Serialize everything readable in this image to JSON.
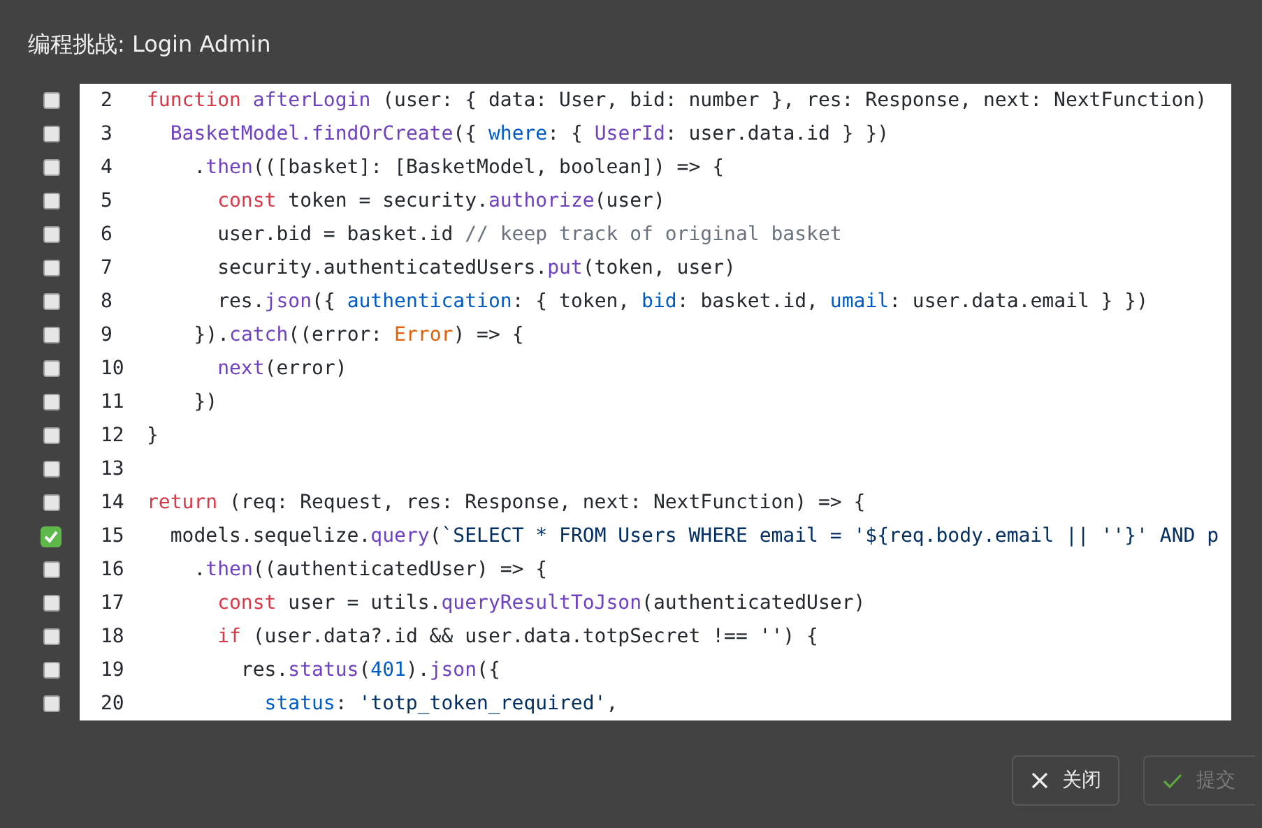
{
  "dialog": {
    "title": "编程挑战: Login Admin"
  },
  "code": {
    "lines": [
      {
        "number": "2",
        "checked": false,
        "tokens": [
          {
            "kind": "kw",
            "text": "function "
          },
          {
            "kind": "fn",
            "text": "afterLogin"
          },
          {
            "kind": "plain",
            "text": " (user: { data: User, bid: number }, res: Response, next: NextFunction)"
          }
        ]
      },
      {
        "number": "3",
        "checked": false,
        "tokens": [
          {
            "kind": "fn",
            "text": "  BasketModel."
          },
          {
            "kind": "fn",
            "text": "findOrCreate"
          },
          {
            "kind": "plain",
            "text": "({ "
          },
          {
            "kind": "prop",
            "text": "where"
          },
          {
            "kind": "plain",
            "text": ": { "
          },
          {
            "kind": "fn",
            "text": "UserId"
          },
          {
            "kind": "plain",
            "text": ": user.data.id } })"
          }
        ]
      },
      {
        "number": "4",
        "checked": false,
        "tokens": [
          {
            "kind": "plain",
            "text": "    ."
          },
          {
            "kind": "fn",
            "text": "then"
          },
          {
            "kind": "plain",
            "text": "(([basket]: [BasketModel, boolean]) => {"
          }
        ]
      },
      {
        "number": "5",
        "checked": false,
        "tokens": [
          {
            "kind": "kw",
            "text": "      const"
          },
          {
            "kind": "plain",
            "text": " token = security."
          },
          {
            "kind": "fn",
            "text": "authorize"
          },
          {
            "kind": "plain",
            "text": "(user)"
          }
        ]
      },
      {
        "number": "6",
        "checked": false,
        "tokens": [
          {
            "kind": "plain",
            "text": "      user.bid = basket.id "
          },
          {
            "kind": "comment",
            "text": "// keep track of original basket"
          }
        ]
      },
      {
        "number": "7",
        "checked": false,
        "tokens": [
          {
            "kind": "plain",
            "text": "      security.authenticatedUsers."
          },
          {
            "kind": "fn",
            "text": "put"
          },
          {
            "kind": "plain",
            "text": "(token, user)"
          }
        ]
      },
      {
        "number": "8",
        "checked": false,
        "tokens": [
          {
            "kind": "plain",
            "text": "      res."
          },
          {
            "kind": "fn",
            "text": "json"
          },
          {
            "kind": "plain",
            "text": "({ "
          },
          {
            "kind": "prop",
            "text": "authentication"
          },
          {
            "kind": "plain",
            "text": ": { token, "
          },
          {
            "kind": "prop",
            "text": "bid"
          },
          {
            "kind": "plain",
            "text": ": basket.id, "
          },
          {
            "kind": "prop",
            "text": "umail"
          },
          {
            "kind": "plain",
            "text": ": user.data.email } })"
          }
        ]
      },
      {
        "number": "9",
        "checked": false,
        "tokens": [
          {
            "kind": "plain",
            "text": "    })."
          },
          {
            "kind": "fn",
            "text": "catch"
          },
          {
            "kind": "plain",
            "text": "((error: "
          },
          {
            "kind": "type",
            "text": "Error"
          },
          {
            "kind": "plain",
            "text": ") => {"
          }
        ]
      },
      {
        "number": "10",
        "checked": false,
        "tokens": [
          {
            "kind": "fn",
            "text": "      next"
          },
          {
            "kind": "plain",
            "text": "(error)"
          }
        ]
      },
      {
        "number": "11",
        "checked": false,
        "tokens": [
          {
            "kind": "plain",
            "text": "    })"
          }
        ]
      },
      {
        "number": "12",
        "checked": false,
        "tokens": [
          {
            "kind": "plain",
            "text": "}"
          }
        ]
      },
      {
        "number": "13",
        "checked": false
      },
      {
        "number": "14",
        "checked": false,
        "tokens": [
          {
            "kind": "kw",
            "text": "return"
          },
          {
            "kind": "plain",
            "text": " (req: Request, res: Response, next: NextFunction) => {"
          }
        ]
      },
      {
        "number": "15",
        "checked": true,
        "tokens": [
          {
            "kind": "plain",
            "text": "  models.sequelize."
          },
          {
            "kind": "fn",
            "text": "query"
          },
          {
            "kind": "plain",
            "text": "("
          },
          {
            "kind": "str",
            "text": "`SELECT * FROM Users WHERE email = '${req.body.email || ''}' AND p"
          }
        ]
      },
      {
        "number": "16",
        "checked": false,
        "tokens": [
          {
            "kind": "plain",
            "text": "    ."
          },
          {
            "kind": "fn",
            "text": "then"
          },
          {
            "kind": "plain",
            "text": "((authenticatedUser) => {"
          }
        ]
      },
      {
        "number": "17",
        "checked": false,
        "tokens": [
          {
            "kind": "kw",
            "text": "      const"
          },
          {
            "kind": "plain",
            "text": " user = utils."
          },
          {
            "kind": "fn",
            "text": "queryResultToJson"
          },
          {
            "kind": "plain",
            "text": "(authenticatedUser)"
          }
        ]
      },
      {
        "number": "18",
        "checked": false,
        "tokens": [
          {
            "kind": "kw",
            "text": "      if"
          },
          {
            "kind": "plain",
            "text": " (user.data?.id && user.data.totpSecret !== '') {"
          }
        ]
      },
      {
        "number": "19",
        "checked": false,
        "tokens": [
          {
            "kind": "plain",
            "text": "        res."
          },
          {
            "kind": "fn",
            "text": "status"
          },
          {
            "kind": "plain",
            "text": "("
          },
          {
            "kind": "prop",
            "text": "401"
          },
          {
            "kind": "plain",
            "text": ")."
          },
          {
            "kind": "fn",
            "text": "json"
          },
          {
            "kind": "plain",
            "text": "({"
          }
        ]
      },
      {
        "number": "20",
        "checked": false,
        "tokens": [
          {
            "kind": "prop",
            "text": "          status"
          },
          {
            "kind": "plain",
            "text": ": "
          },
          {
            "kind": "str",
            "text": "'totp_token_required'"
          },
          {
            "kind": "plain",
            "text": ","
          }
        ]
      }
    ]
  },
  "buttons": [
    {
      "kind": "close",
      "label": "关闭",
      "disabled": false
    },
    {
      "kind": "submit",
      "label": "提交",
      "disabled": true
    }
  ]
}
